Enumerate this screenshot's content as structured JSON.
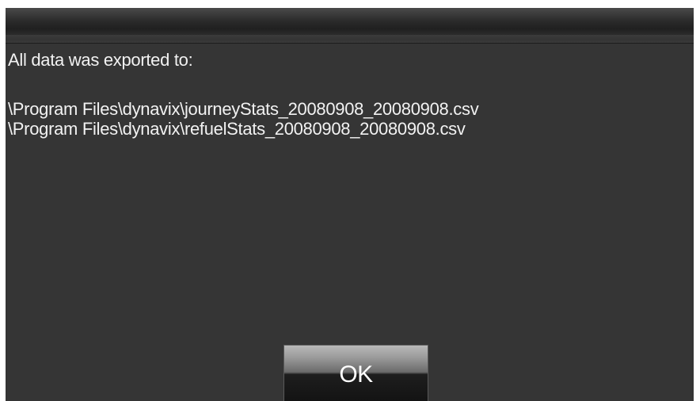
{
  "dialog": {
    "message": "All data was exported to:",
    "paths": [
      "\\Program Files\\dynavix\\journeyStats_20080908_20080908.csv",
      "\\Program Files\\dynavix\\refuelStats_20080908_20080908.csv"
    ],
    "ok_label": "OK"
  },
  "colors": {
    "dialog_background": "#353535",
    "text": "#f2f2f2",
    "titlebar": "#2c2c2c"
  }
}
